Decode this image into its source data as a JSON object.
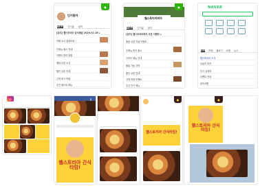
{
  "panels": {
    "p1": {
      "title": "인기동아",
      "row0": "[공지] 웹스토리아 공식채널 2020.02.26 ▸",
      "rows": [
        "카페 소식 업데이트",
        "신메뉴 출시 안내",
        "이벤트 참여 방법",
        "매장 오픈 소식",
        "할인 쿠폰 안내",
        "고객 후기 모음",
        "주간 베스트 메뉴"
      ]
    },
    "p2": {
      "title": "웹스토리아피자",
      "banner": "웹스토리아피자 오픈!",
      "row0": "[공지] 웹스토리아피자 오픈 이벤트 ▸",
      "rows": [
        "매장 오픈 기념 이벤트",
        "신메뉴 피자 출시",
        "사이드 메뉴 안내",
        "배달 가능 지역",
        "할인 쿠폰 안내",
        "고객 리뷰 이벤트",
        "주간 인기 메뉴"
      ]
    },
    "p3": {
      "logo": "NAVER",
      "tabs": [
        "메일",
        "카페",
        "블로그",
        "쇼핑",
        "뉴스"
      ],
      "rows": [
        "웹스토리아 소식",
        "오늘의 추천",
        "인기 검색어",
        "이벤트 안내",
        "공지사항"
      ]
    },
    "p4": {
      "bar": "검색"
    },
    "p5": {
      "bar": "웹스토리아",
      "promo": "웹스토리아 간식타임!"
    },
    "p6": {
      "title": "웹스토리아"
    },
    "p7": {
      "promo": "웹스토리아 간식타임!"
    },
    "p8": {
      "promo": "웹스토리아 간식타임!"
    },
    "tabs_common": [
      "전체글",
      "인기글",
      "공지",
      "이벤트"
    ]
  }
}
